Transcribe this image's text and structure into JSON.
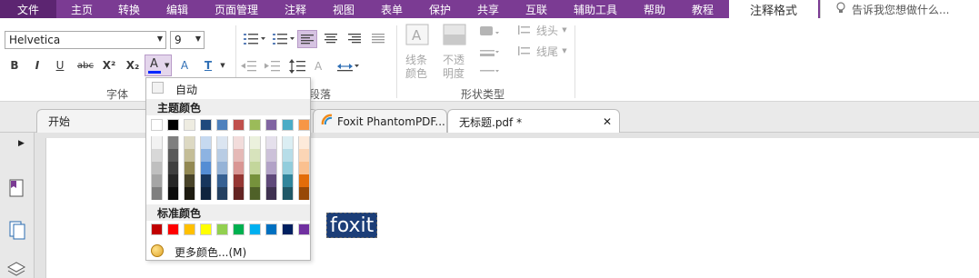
{
  "menubar": {
    "file": "文件",
    "items": [
      "主页",
      "转换",
      "编辑",
      "页面管理",
      "注释",
      "视图",
      "表单",
      "保护",
      "共享",
      "互联",
      "辅助工具",
      "帮助",
      "教程"
    ],
    "active_tab": "注释格式",
    "tell_me": "告诉我您想做什么..."
  },
  "ribbon": {
    "font_name": "Helvetica",
    "font_size": "9",
    "format_buttons": {
      "bold": "B",
      "italic": "I",
      "underline": "U",
      "strike": "abc",
      "superscript": "X²",
      "subscript": "X₂",
      "font_color": "A",
      "char_spacing": "A",
      "text_box": "T"
    },
    "font_group_label": "字体",
    "paragraph_group_label": "段落",
    "shape_buttons": {
      "line_color": "线条\n颜色",
      "opacity": "不透\n明度"
    },
    "shape_group_label": "形状类型",
    "line_head_label": "线头",
    "line_tail_label": "线尾"
  },
  "tabs": {
    "items": [
      {
        "label": "开始"
      },
      {
        "label": "Foxit PhantomPDF..."
      },
      {
        "label": "无标题.pdf *"
      }
    ]
  },
  "document": {
    "selected_text": "foxit"
  },
  "color_popup": {
    "auto_label": "自动",
    "theme_header": "主题颜色",
    "standard_header": "标准颜色",
    "more_colors_label": "更多颜色...(M)",
    "theme_top": [
      "#ffffff",
      "#000000",
      "#eeece1",
      "#1f497d",
      "#4f81bd",
      "#c0504d",
      "#9bbb59",
      "#8064a2",
      "#4bacc6",
      "#f79646"
    ],
    "theme_shades": [
      [
        "#f2f2f2",
        "#7f7f7f",
        "#ddd9c3",
        "#c6d9f0",
        "#dbe5f1",
        "#f2dcdb",
        "#ebf1dd",
        "#e5e0ec",
        "#dbeef3",
        "#fdeada"
      ],
      [
        "#d8d8d8",
        "#595959",
        "#c4bd97",
        "#8db3e2",
        "#b8cce4",
        "#e5b9b7",
        "#d7e3bc",
        "#ccc1d9",
        "#b7dde8",
        "#fbd5b5"
      ],
      [
        "#bfbfbf",
        "#3f3f3f",
        "#938953",
        "#548dd4",
        "#95b3d7",
        "#d99694",
        "#c3d69b",
        "#b2a2c7",
        "#92cddc",
        "#fac08f"
      ],
      [
        "#a5a5a5",
        "#262626",
        "#494429",
        "#17365d",
        "#366092",
        "#953734",
        "#76923c",
        "#5f497a",
        "#31859b",
        "#e36c09"
      ],
      [
        "#7f7f7f",
        "#0c0c0c",
        "#1d1b10",
        "#0f243e",
        "#244061",
        "#632423",
        "#4f6128",
        "#3f3151",
        "#205867",
        "#974806"
      ]
    ],
    "standard": [
      "#c00000",
      "#ff0000",
      "#ffc000",
      "#ffff00",
      "#92d050",
      "#00b050",
      "#00b0f0",
      "#0070c0",
      "#002060",
      "#7030a0"
    ]
  }
}
